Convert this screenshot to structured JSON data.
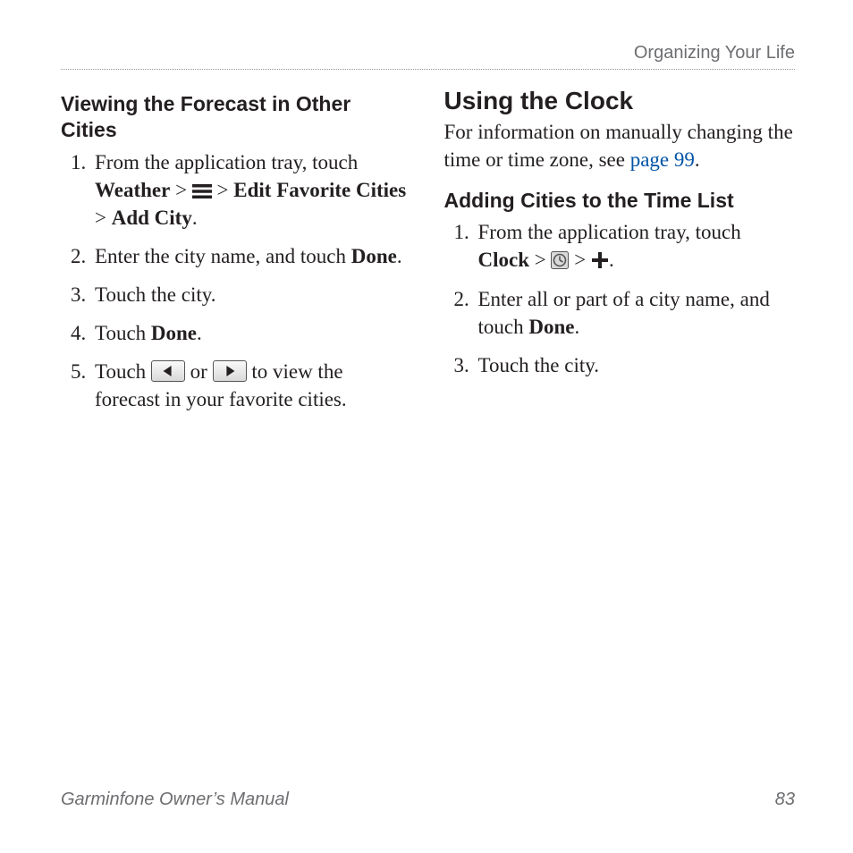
{
  "running_head": "Organizing Your Life",
  "left": {
    "heading": "Viewing the Forecast in Other Cities",
    "step1_a": "From the application tray, touch ",
    "step1_b": "Weather",
    "step1_c": " > ",
    "step1_d": " > ",
    "step1_e": "Edit Favorite Cities",
    "step1_f": " > ",
    "step1_g": "Add City",
    "step1_h": ".",
    "step2_a": "Enter the city name, and touch ",
    "step2_b": "Done",
    "step2_c": ".",
    "step3": "Touch the city.",
    "step4_a": "Touch ",
    "step4_b": "Done",
    "step4_c": ".",
    "step5_a": "Touch ",
    "step5_b": " or ",
    "step5_c": " to view the forecast in your favorite cities."
  },
  "right": {
    "heading": "Using the Clock",
    "lead_a": "For information on manually changing the time or time zone, see ",
    "lead_link": "page 99",
    "lead_b": ".",
    "subheading": "Adding Cities to the Time List",
    "step1_a": "From the application tray, touch ",
    "step1_b": "Clock",
    "step1_c": " > ",
    "step1_d": " > ",
    "step1_e": ".",
    "step2_a": "Enter all or part of a city name, and touch ",
    "step2_b": "Done",
    "step2_c": ".",
    "step3": "Touch the city."
  },
  "footer": {
    "manual_title": "Garminfone Owner’s Manual",
    "page_number": "83"
  }
}
